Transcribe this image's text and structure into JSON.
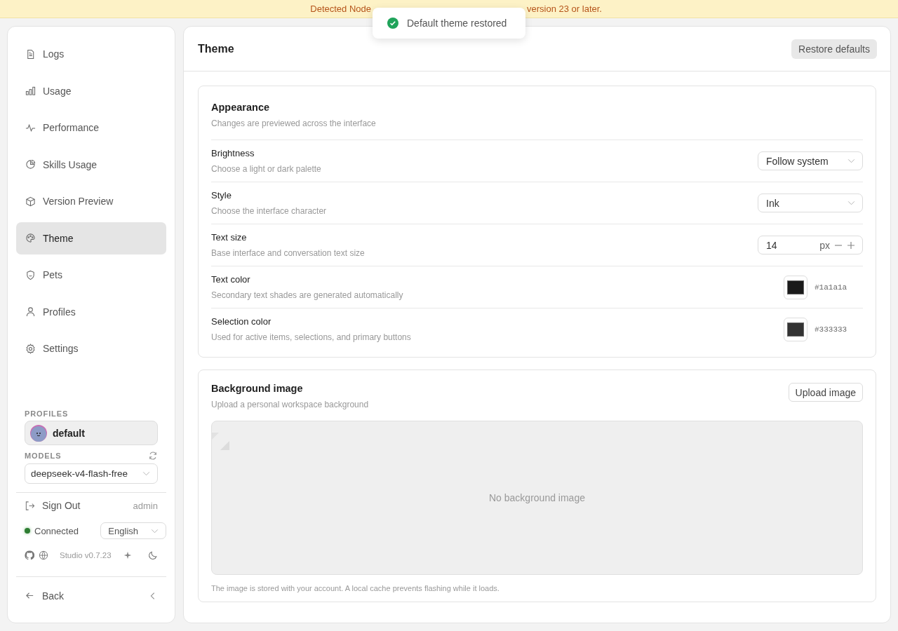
{
  "banner": {
    "text_start": "Detected Node",
    "text_end": "version 23 or later."
  },
  "toast": {
    "text": "Default theme restored"
  },
  "sidebar": {
    "items": [
      {
        "label": "Logs",
        "selected": false
      },
      {
        "label": "Usage",
        "selected": false
      },
      {
        "label": "Performance",
        "selected": false
      },
      {
        "label": "Skills Usage",
        "selected": false
      },
      {
        "label": "Version Preview",
        "selected": false
      },
      {
        "label": "Theme",
        "selected": true
      },
      {
        "label": "Pets",
        "selected": false
      },
      {
        "label": "Profiles",
        "selected": false
      },
      {
        "label": "Settings",
        "selected": false
      }
    ],
    "profiles_heading": "PROFILES",
    "profile": "default",
    "models_heading": "MODELS",
    "model": "deepseek-v4-flash-free",
    "sign_out": "Sign Out",
    "user": "admin",
    "status": "Connected",
    "connected": true,
    "language": "English",
    "version": "Studio v0.7.23",
    "back": "Back"
  },
  "main": {
    "title": "Theme",
    "restore_button": "Restore defaults",
    "appearance": {
      "title": "Appearance",
      "subtitle": "Changes are previewed across the interface",
      "rows": [
        {
          "kind": "select",
          "label": "Brightness",
          "hint": "Choose a light or dark palette",
          "value": "Follow system"
        },
        {
          "kind": "select",
          "label": "Style",
          "hint": "Choose the interface character",
          "value": "Ink"
        },
        {
          "kind": "number",
          "label": "Text size",
          "hint": "Base interface and conversation text size",
          "value": "14",
          "unit": "px"
        },
        {
          "kind": "color",
          "label": "Text color",
          "hint": "Secondary text shades are generated automatically",
          "value": "#1a1a1a",
          "color": "#1a1a1a"
        },
        {
          "kind": "color",
          "label": "Selection color",
          "hint": "Used for active items, selections, and primary buttons",
          "value": "#333333",
          "color": "#333333"
        }
      ]
    },
    "background": {
      "title": "Background image",
      "subtitle": "Upload a personal workspace background",
      "upload_button": "Upload image",
      "empty": "No background image",
      "note": "The image is stored with your account. A local cache prevents flashing while it loads."
    }
  }
}
